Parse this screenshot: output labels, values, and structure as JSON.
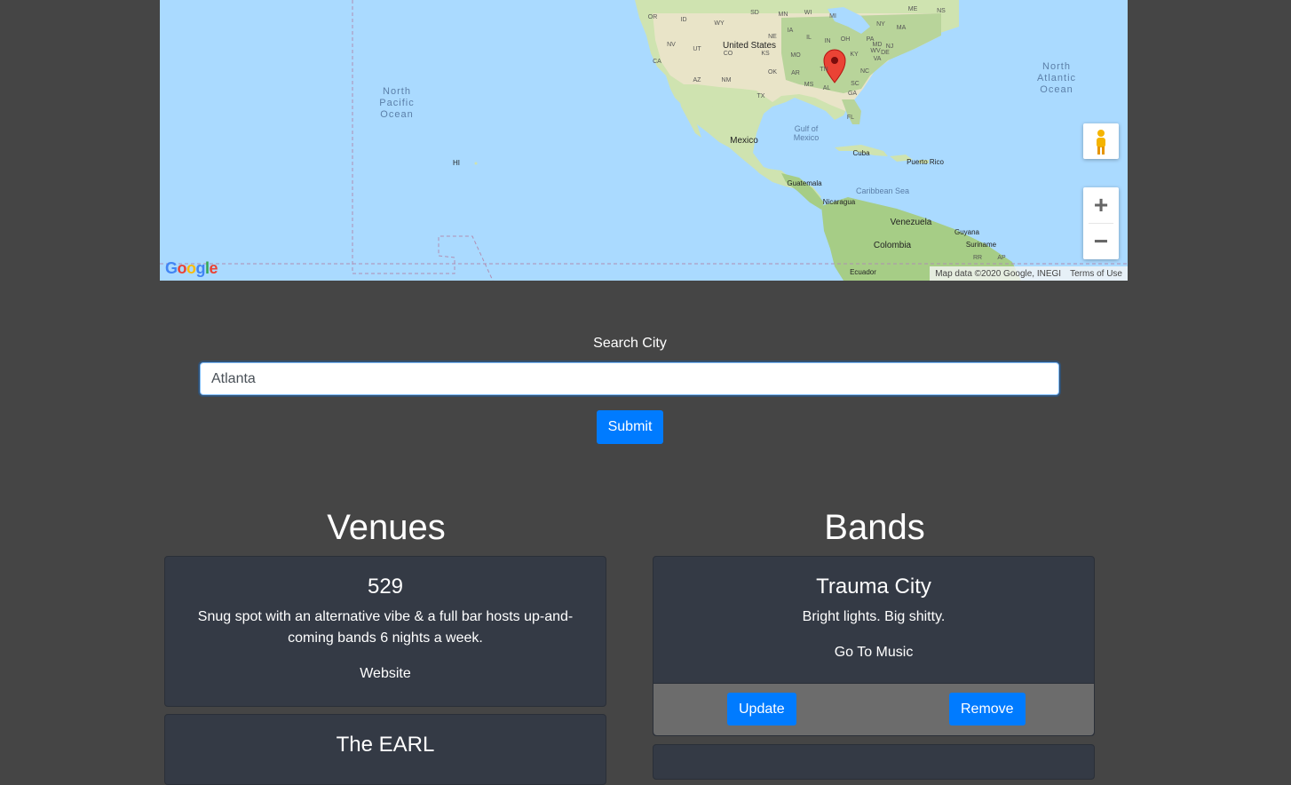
{
  "map": {
    "labels": {
      "north_pacific": [
        "North",
        "Pacific",
        "Ocean"
      ],
      "north_atlantic": [
        "North",
        "Atlantic",
        "Ocean"
      ],
      "united_states": "United States",
      "mexico": "Mexico",
      "gulf": [
        "Gulf of",
        "Mexico"
      ],
      "cuba": "Cuba",
      "puerto_rico": "Puerto Rico",
      "caribbean": "Caribbean Sea",
      "guatemala": "Guatemala",
      "nicaragua": "Nicaragua",
      "venezuela": "Venezuela",
      "colombia": "Colombia",
      "guyana": "Guyana",
      "suriname": "Suriname",
      "ecuador": "Ecuador",
      "hawaii": "HI",
      "states": [
        "OR",
        "ID",
        "WY",
        "SD",
        "MN",
        "WI",
        "MI",
        "NY",
        "ME",
        "NS",
        "NV",
        "UT",
        "CO",
        "KS",
        "MO",
        "IL",
        "IN",
        "OH",
        "PA",
        "NJ",
        "MA",
        "CA",
        "AZ",
        "NM",
        "OK",
        "AR",
        "TN",
        "KY",
        "WV",
        "VA",
        "MD",
        "DE",
        "NE",
        "IA",
        "TX",
        "MS",
        "AL",
        "GA",
        "SC",
        "NC",
        "FL",
        "AP",
        "RR"
      ]
    },
    "credit": "Map data ©2020 Google, INEGI",
    "terms": "Terms of Use",
    "logo": "Google",
    "zoom_in": "+",
    "zoom_out": "−"
  },
  "search": {
    "label": "Search City",
    "value": "Atlanta",
    "submit": "Submit"
  },
  "venues": {
    "title": "Venues",
    "items": [
      {
        "name": "529",
        "description": "Snug spot with an alternative vibe & a full bar hosts up-and-coming bands 6 nights a week.",
        "link": "Website"
      },
      {
        "name": "The EARL"
      }
    ]
  },
  "bands": {
    "title": "Bands",
    "items": [
      {
        "name": "Trauma City",
        "description": "Bright lights. Big shitty.",
        "link": "Go To Music",
        "update": "Update",
        "remove": "Remove"
      }
    ]
  },
  "colors": {
    "background": "#454545",
    "card": "#343a45",
    "button": "#007bff",
    "footer": "#6c6c6c",
    "water": "#aadaff",
    "marker": "#ea4335"
  }
}
